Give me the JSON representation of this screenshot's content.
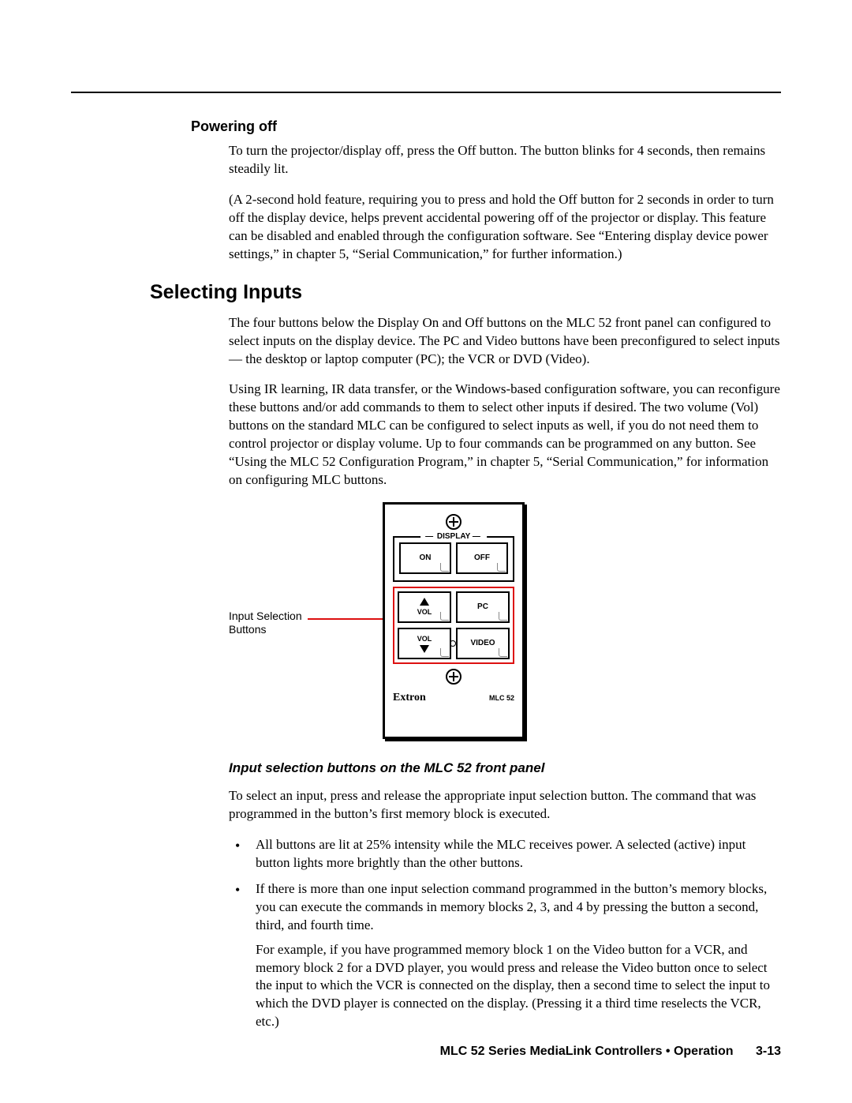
{
  "sec1": {
    "heading": "Powering off",
    "p1": "To turn the projector/display off, press the Off button.   The button blinks for 4 seconds, then remains steadily lit.",
    "p2": "(A 2-second hold feature, requiring you to press and hold the Off button for 2 seconds in order to turn off the display device,  helps prevent accidental powering off of the projector or display.  This feature can be disabled and enabled through the configuration software.  See “Entering display device power settings,” in chapter 5, “Serial Communication,” for further information.)"
  },
  "sec2": {
    "heading": "Selecting Inputs",
    "p1": "The four buttons below the Display On and Off buttons on the MLC 52 front panel can configured to select inputs on the display device.  The PC and Video buttons have been preconfigured to select inputs — the desktop or laptop computer (PC); the VCR or DVD (Video).",
    "p2": "Using IR learning, IR data transfer, or the Windows-based configuration software, you can reconfigure these buttons and/or add commands to them to select other inputs if desired.  The two volume (Vol) buttons on the standard MLC can be configured to select inputs as well, if you do not need them to control projector or display volume.  Up to four commands can be programmed on any button.  See “Using the MLC 52 Configuration Program,” in chapter 5, “Serial Communication,” for information on configuring MLC buttons."
  },
  "figure": {
    "annotation": "Input Selection\nButtons",
    "display_label": "DISPLAY",
    "btn_on": "ON",
    "btn_off": "OFF",
    "btn_vol": "VOL",
    "btn_pc": "PC",
    "btn_video": "VIDEO",
    "brand": "Extron",
    "model": "MLC 52",
    "caption": "Input selection buttons on the MLC 52 front panel"
  },
  "after_fig": {
    "p1": "To select an input, press and release the appropriate input selection button.  The command that was programmed in the button’s first memory block is executed.",
    "li1": "All buttons are lit at 25% intensity while the MLC receives power.  A selected (active) input button lights more brightly than the other buttons.",
    "li2": "If there is more than one input selection command programmed in the button’s memory blocks, you can execute the commands in memory blocks 2, 3, and 4 by pressing the button a second, third, and fourth time.",
    "li2b": "For example, if you have programmed memory block 1 on the Video button for a VCR, and memory block 2 for a DVD player, you would press and release the Video button once to select the input to which the VCR is connected on the display, then a second time to select the input to which the DVD player is connected on the display.  (Pressing it a third time reselects the VCR, etc.)"
  },
  "footer": {
    "title": "MLC 52 Series MediaLink Controllers • Operation",
    "page": "3-13"
  }
}
